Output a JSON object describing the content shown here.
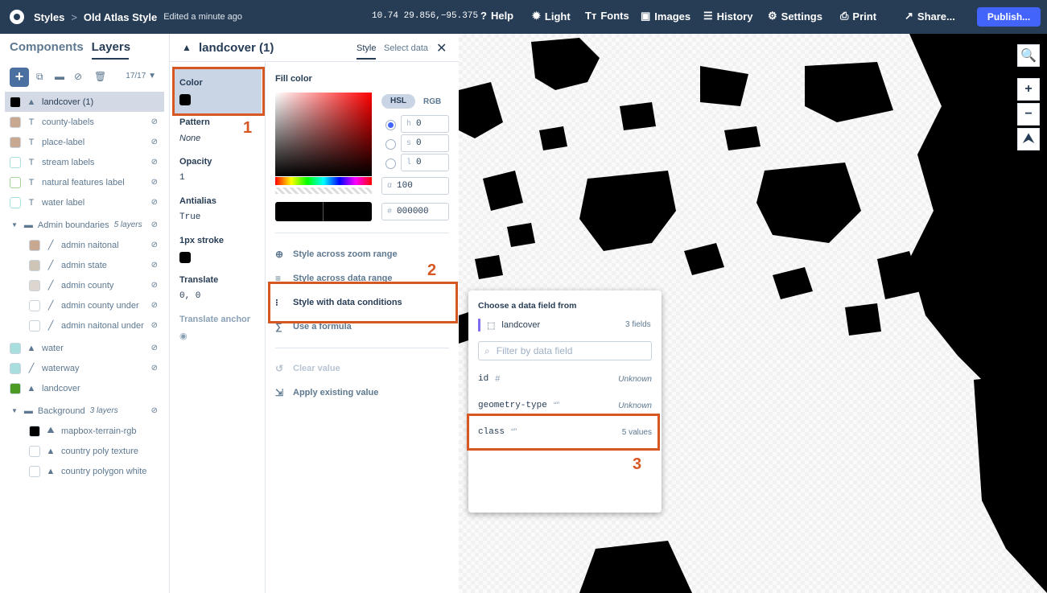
{
  "topbar": {
    "breadcrumb_root": "Styles",
    "breadcrumb_sep": ">",
    "style_name": "Old Atlas Style",
    "edited": "Edited a minute ago",
    "zoom": "10.74",
    "coords": "29.856,−95.375",
    "help": "Help",
    "light": "Light",
    "fonts": "Fonts",
    "images": "Images",
    "history": "History",
    "settings": "Settings",
    "print": "Print",
    "share": "Share...",
    "publish": "Publish..."
  },
  "left": {
    "tab_components": "Components",
    "tab_layers": "Layers",
    "add": "+",
    "count": "17/17",
    "layers": [
      {
        "label": "landcover (1)",
        "swatch": "#000000",
        "icon": "fill",
        "selected": true
      },
      {
        "label": "county-labels",
        "swatch": "#c9a892",
        "icon": "T"
      },
      {
        "label": "place-label",
        "swatch": "#c9a892",
        "icon": "T"
      },
      {
        "label": "stream labels",
        "swatch": "#ffffff",
        "border": "#a9dede",
        "icon": "T"
      },
      {
        "label": "natural features label",
        "swatch": "#ffffff",
        "border": "#a3d19a",
        "icon": "T"
      },
      {
        "label": "water label",
        "swatch": "#ffffff",
        "border": "#a9dede",
        "icon": "T"
      }
    ],
    "admin_group": {
      "label": "Admin boundaries",
      "note": "5 layers"
    },
    "admin_layers": [
      {
        "label": "admin naitonal",
        "swatch": "#c9a892"
      },
      {
        "label": "admin state",
        "swatch": "#cfc5b6"
      },
      {
        "label": "admin county",
        "swatch": "#dcd6cf"
      },
      {
        "label": "admin county under",
        "swatch": "#ffffff"
      },
      {
        "label": "admin naitonal under",
        "swatch": "#ffffff"
      }
    ],
    "base_layers": [
      {
        "label": "water",
        "swatch": "#a9dede",
        "icon": "fill"
      },
      {
        "label": "waterway",
        "swatch": "#a9dede",
        "icon": "line"
      },
      {
        "label": "landcover",
        "swatch": "#4a9a24",
        "icon": "fill"
      }
    ],
    "bg_group": {
      "label": "Background",
      "note": "3 layers"
    },
    "bg_layers": [
      {
        "label": "mapbox-terrain-rgb",
        "swatch": "#000000",
        "icon": "hillshade"
      },
      {
        "label": "country poly texture",
        "swatch": "#ffffff",
        "icon": "fill"
      },
      {
        "label": "country polygon white",
        "swatch": "#ffffff",
        "icon": "fill"
      }
    ]
  },
  "panel": {
    "title": "landcover (1)",
    "tab_style": "Style",
    "tab_select": "Select data",
    "props": {
      "color": "Color",
      "pattern": "Pattern",
      "pattern_value": "None",
      "opacity": "Opacity",
      "opacity_value": "1",
      "antialias": "Antialias",
      "antialias_value": "True",
      "stroke": "1px stroke",
      "translate": "Translate",
      "translate_value": "0, 0",
      "anchor": "Translate anchor"
    },
    "fill_color": "Fill color",
    "hsl": "HSL",
    "rgb": "RGB",
    "h": "0",
    "s": "0",
    "l": "0",
    "alpha": "100",
    "hex": "000000",
    "h_label": "h",
    "s_label": "s",
    "l_label": "l",
    "alpha_label": "α",
    "hex_label": "#",
    "actions": {
      "zoom": "Style across zoom range",
      "data_range": "Style across data range",
      "conditions": "Style with data conditions",
      "formula": "Use a formula",
      "clear": "Clear value",
      "existing": "Apply existing value"
    }
  },
  "popup": {
    "heading": "Choose a data field from",
    "source": "landcover",
    "fields_count": "3 fields",
    "filter_placeholder": "Filter by data field",
    "fields": [
      {
        "name": "id",
        "type": "#",
        "value": "Unknown"
      },
      {
        "name": "geometry-type",
        "type": "“”",
        "value": "Unknown"
      },
      {
        "name": "class",
        "type": "“”",
        "value": "5 values"
      }
    ]
  },
  "annotations": {
    "one": "1",
    "two": "2",
    "three": "3",
    "color": "#d75722"
  },
  "map": {
    "zoom_in": "+",
    "zoom_out": "−",
    "compass": "⮝"
  }
}
